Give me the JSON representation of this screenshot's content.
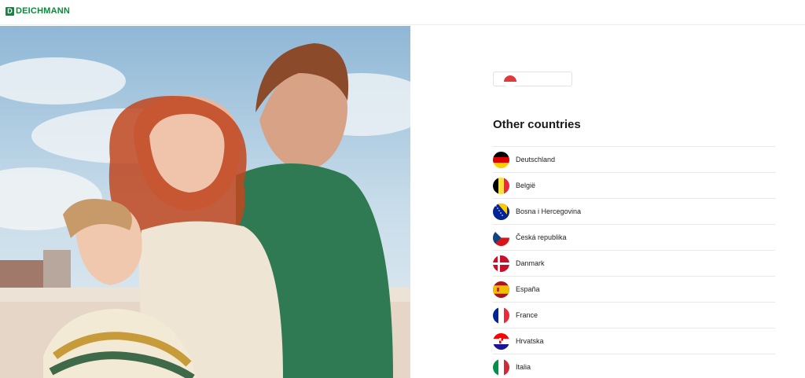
{
  "header": {
    "brand": "DEICHMANN",
    "brand_mark": "D",
    "brand_color": "#0a8a3a"
  },
  "hero": {
    "image": "family-photo"
  },
  "country_selector": {
    "flag_icon": "flag-icon"
  },
  "other_countries": {
    "heading": "Other countries",
    "items": [
      {
        "label": "Deutschland",
        "flag": "de-flag-icon"
      },
      {
        "label": "België",
        "flag": "be-flag-icon"
      },
      {
        "label": "Bosna i Hercegovina",
        "flag": "ba-flag-icon"
      },
      {
        "label": "Česká republika",
        "flag": "cz-flag-icon"
      },
      {
        "label": "Danmark",
        "flag": "dk-flag-icon"
      },
      {
        "label": "España",
        "flag": "es-flag-icon"
      },
      {
        "label": "France",
        "flag": "fr-flag-icon"
      },
      {
        "label": "Hrvatska",
        "flag": "hr-flag-icon"
      },
      {
        "label": "Italia",
        "flag": "it-flag-icon"
      }
    ]
  }
}
